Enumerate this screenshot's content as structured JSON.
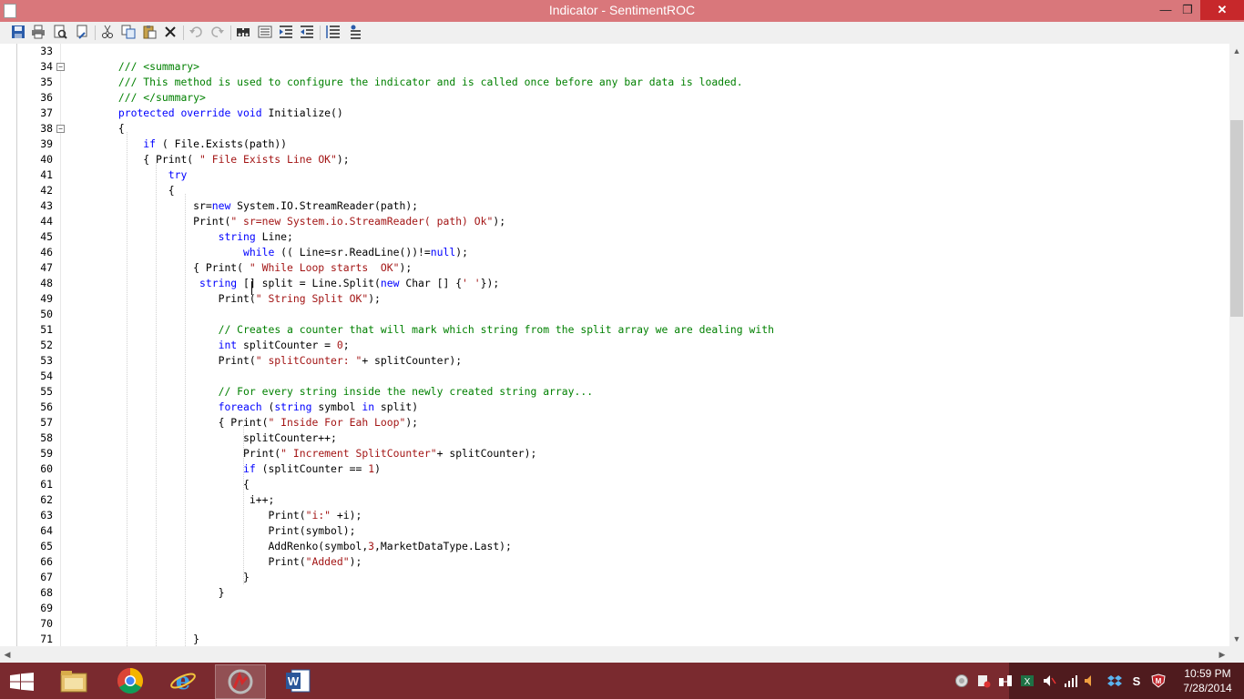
{
  "window": {
    "title": "Indicator - SentimentROC",
    "minimize_glyph": "—",
    "maximize_glyph": "❐",
    "close_glyph": "✕"
  },
  "toolbar": {
    "buttons": [
      {
        "name": "save-icon"
      },
      {
        "name": "print-icon"
      },
      {
        "name": "print-preview-icon"
      },
      {
        "name": "page-setup-icon"
      },
      {
        "name": "cut-icon"
      },
      {
        "name": "copy-icon"
      },
      {
        "name": "paste-icon"
      },
      {
        "name": "delete-icon"
      },
      {
        "name": "undo-icon"
      },
      {
        "name": "redo-icon"
      },
      {
        "name": "find-icon"
      },
      {
        "name": "line-numbers-icon"
      },
      {
        "name": "indent-icon"
      },
      {
        "name": "outdent-icon"
      },
      {
        "name": "comment-icon"
      },
      {
        "name": "uncomment-icon"
      }
    ]
  },
  "code_lines": [
    {
      "n": "33",
      "html": ""
    },
    {
      "n": "34",
      "fold": "−",
      "html": "        <span class=\"cm\">/// &lt;summary&gt;</span>"
    },
    {
      "n": "35",
      "html": "        <span class=\"cm\">/// This method is used to configure the indicator and is called once before any bar data is loaded.</span>"
    },
    {
      "n": "36",
      "html": "        <span class=\"cm\">/// &lt;/summary&gt;</span>"
    },
    {
      "n": "37",
      "html": "        <span class=\"kw\">protected override void</span> Initialize()"
    },
    {
      "n": "38",
      "fold": "−",
      "html": "        {"
    },
    {
      "n": "39",
      "html": "            <span class=\"kw\">if</span> ( File.Exists(path))"
    },
    {
      "n": "40",
      "html": "            { Print( <span class=\"st\">\" File Exists Line OK\"</span>);"
    },
    {
      "n": "41",
      "html": "                <span class=\"kw\">try</span>"
    },
    {
      "n": "42",
      "html": "                {"
    },
    {
      "n": "43",
      "html": "                    sr=<span class=\"kw\">new</span> System.IO.StreamReader(path);"
    },
    {
      "n": "44",
      "html": "                    Print(<span class=\"st\">\" sr=new System.io.StreamReader( path) Ok\"</span>);"
    },
    {
      "n": "45",
      "html": "                        <span class=\"kw\">string</span> Line;"
    },
    {
      "n": "46",
      "html": "                            <span class=\"kw\">while</span> (( Line=sr.ReadLine())!=<span class=\"kw\">null</span>);"
    },
    {
      "n": "47",
      "html": "                    { Print( <span class=\"st\">\" While Loop starts  OK\"</span>);"
    },
    {
      "n": "48",
      "html": "                     <span class=\"kw\">string</span> [] split = Line.Split(<span class=\"kw\">new</span> Char [] {<span class=\"st\">' '</span>});"
    },
    {
      "n": "49",
      "html": "                        Print(<span class=\"st\">\" String Split OK\"</span>);"
    },
    {
      "n": "50",
      "html": ""
    },
    {
      "n": "51",
      "html": "                        <span class=\"cm\">// Creates a counter that will mark which string from the split array we are dealing with</span>"
    },
    {
      "n": "52",
      "html": "                        <span class=\"kw\">int</span> splitCounter = <span class=\"nm\">0</span>;"
    },
    {
      "n": "53",
      "html": "                        Print(<span class=\"st\">\" splitCounter: \"</span>+ splitCounter);"
    },
    {
      "n": "54",
      "html": ""
    },
    {
      "n": "55",
      "html": "                        <span class=\"cm\">// For every string inside the newly created string array...</span>"
    },
    {
      "n": "56",
      "html": "                        <span class=\"kw\">foreach</span> (<span class=\"kw\">string</span> symbol <span class=\"kw\">in</span> split)"
    },
    {
      "n": "57",
      "html": "                        { Print(<span class=\"st\">\" Inside For Eah Loop\"</span>);"
    },
    {
      "n": "58",
      "html": "                            splitCounter++;"
    },
    {
      "n": "59",
      "html": "                            Print(<span class=\"st\">\" Increment SplitCounter\"</span>+ splitCounter);"
    },
    {
      "n": "60",
      "html": "                            <span class=\"kw\">if</span> (splitCounter == <span class=\"nm\">1</span>)"
    },
    {
      "n": "61",
      "html": "                            {"
    },
    {
      "n": "62",
      "html": "                             i++;"
    },
    {
      "n": "63",
      "html": "                                Print(<span class=\"st\">\"i:\"</span> +i);"
    },
    {
      "n": "64",
      "html": "                                Print(symbol);"
    },
    {
      "n": "65",
      "html": "                                AddRenko(symbol,<span class=\"nm\">3</span>,MarketDataType.Last);"
    },
    {
      "n": "66",
      "html": "                                Print(<span class=\"st\">\"Added\"</span>);"
    },
    {
      "n": "67",
      "html": "                            }"
    },
    {
      "n": "68",
      "html": "                        }"
    },
    {
      "n": "69",
      "html": ""
    },
    {
      "n": "70",
      "html": ""
    },
    {
      "n": "71",
      "html": "                    }"
    }
  ],
  "scrollbars": {
    "up_glyph": "▲",
    "down_glyph": "▼",
    "left_glyph": "◀",
    "right_glyph": "▶"
  },
  "taskbar": {
    "apps": [
      {
        "name": "file-explorer-icon"
      },
      {
        "name": "chrome-icon"
      },
      {
        "name": "internet-explorer-icon"
      },
      {
        "name": "ninjatrader-icon"
      },
      {
        "name": "word-icon"
      }
    ],
    "clock_time": "10:59 PM",
    "clock_date": "7/28/2014"
  }
}
